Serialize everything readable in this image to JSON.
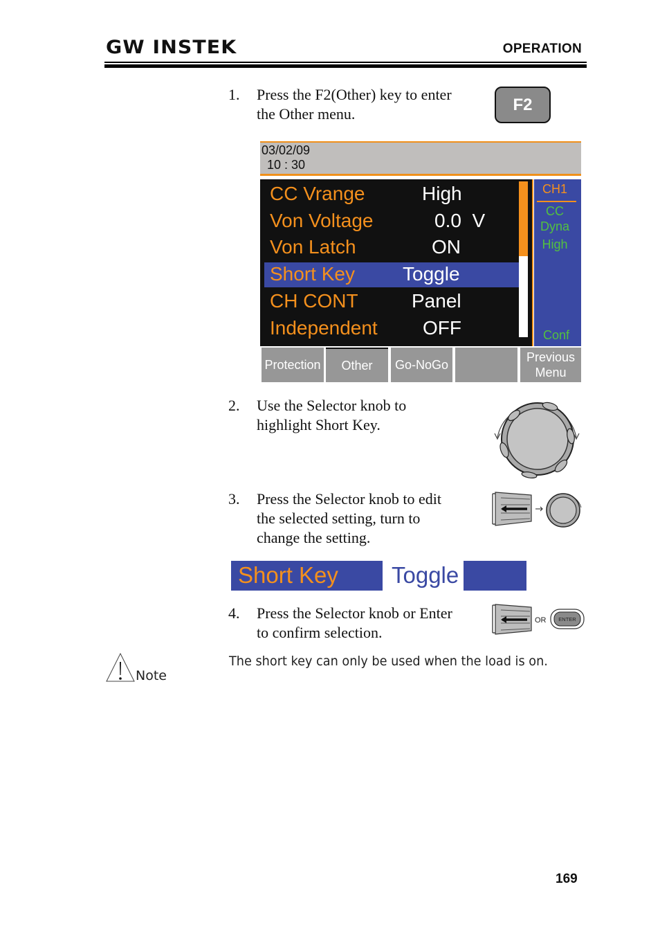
{
  "header": {
    "logo": "GW INSTEK",
    "section": "OPERATION"
  },
  "steps": [
    {
      "num": "1.",
      "lines": [
        "Press the F2(Other) key to enter",
        "the Other menu."
      ]
    },
    {
      "num": "2.",
      "lines": [
        "Use the Selector knob to",
        "highlight Short Key."
      ]
    },
    {
      "num": "3.",
      "lines": [
        "Press the Selector knob to edit",
        "the selected setting, turn to",
        "change the setting."
      ]
    },
    {
      "num": "4.",
      "lines": [
        "Press the Selector knob or Enter",
        "to confirm selection."
      ]
    }
  ],
  "f2_key": {
    "label": "F2"
  },
  "screen": {
    "date": "03/02/09",
    "time": "10 : 30",
    "rows": [
      {
        "label": "CC Vrange",
        "value": "High",
        "selected": false
      },
      {
        "label": "Von Voltage",
        "value": "0.0  V",
        "selected": false
      },
      {
        "label": "Von Latch",
        "value": "ON",
        "selected": false
      },
      {
        "label": "Short Key",
        "value": "Toggle",
        "selected": true
      },
      {
        "label": "CH CONT",
        "value": "Panel",
        "selected": false
      },
      {
        "label": "Independent",
        "value": "OFF",
        "selected": false
      }
    ],
    "scroll_position": 0.48,
    "side": {
      "channel": "CH1",
      "mode": "CC",
      "dyna": "Dyna",
      "range": "High",
      "conf": "Conf"
    },
    "softkeys": [
      "Protection",
      "Other",
      "Go-NoGo",
      "",
      "Previous Menu"
    ],
    "active_softkey": "Other",
    "colors": {
      "label": "#f4901d",
      "value": "#ffffff",
      "highlight": "#3a49a3",
      "side_text": "#53c13f"
    }
  },
  "zoomed_setting": {
    "label": "Short Key",
    "value": "Toggle"
  },
  "illustrations": {
    "or_label": "OR",
    "enter_label": "ENTER"
  },
  "note": {
    "label": "Note",
    "text": "The short key can only be used when the load is on."
  },
  "page_number": "169"
}
